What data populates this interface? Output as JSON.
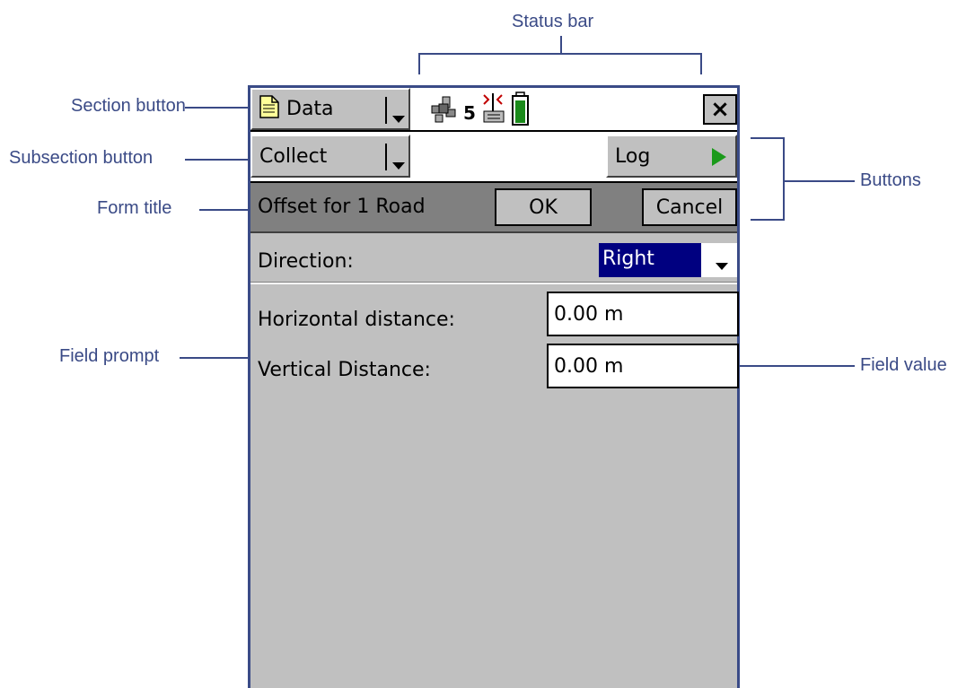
{
  "callouts": {
    "status_bar": "Status bar",
    "section_button": "Section button",
    "subsection_button": "Subsection button",
    "form_title": "Form title",
    "field_prompt": "Field prompt",
    "buttons": "Buttons",
    "field_value": "Field value"
  },
  "status_bar": {
    "section_label": "Data",
    "satellite_count": "5",
    "close_label": "×"
  },
  "subsection": {
    "label": "Collect",
    "log_label": "Log"
  },
  "form": {
    "title": "Offset for 1 Road",
    "ok_label": "OK",
    "cancel_label": "Cancel"
  },
  "fields": {
    "direction_prompt": "Direction:",
    "direction_value": "Right",
    "horizontal_prompt": "Horizontal distance:",
    "horizontal_value": "0.00 m",
    "vertical_prompt": "Vertical Distance:",
    "vertical_value": "0.00 m"
  },
  "colors": {
    "callout": "#3a4a86",
    "selection": "#000080",
    "log_arrow": "#1a9a1a",
    "battery": "#1a8a1a"
  }
}
